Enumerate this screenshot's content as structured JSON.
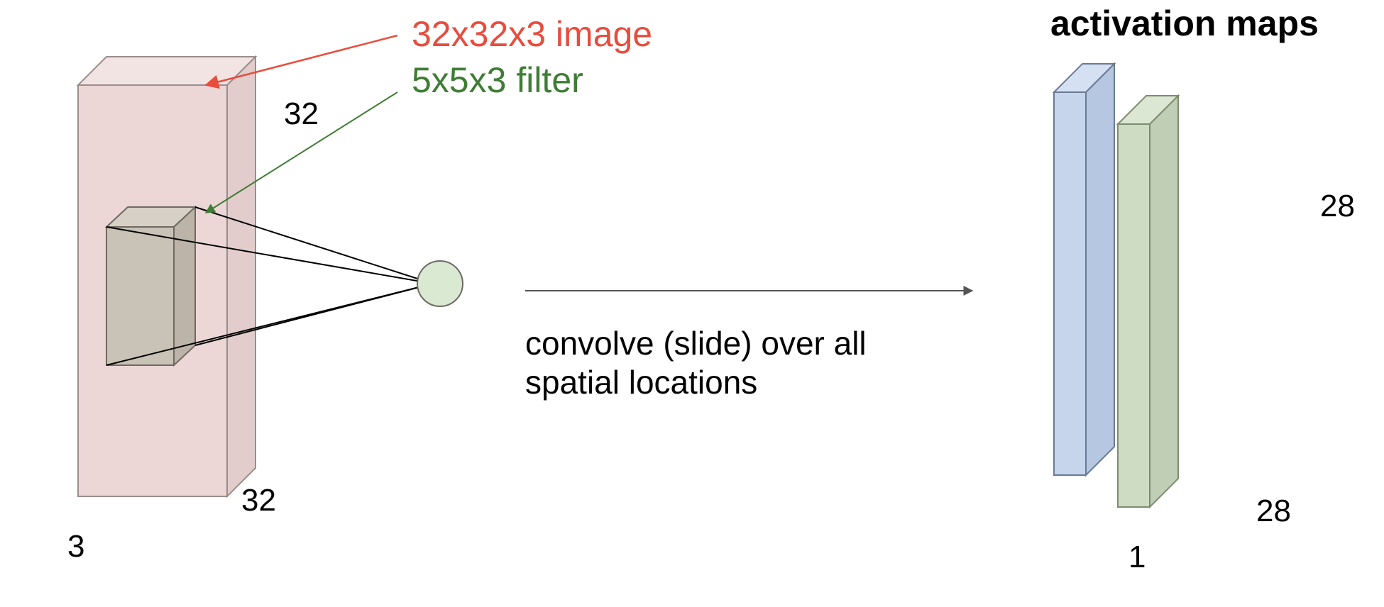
{
  "labels": {
    "image": "32x32x3 image",
    "filter": "5x5x3 filter",
    "activation_maps": "activation maps",
    "convolve_line1": "convolve (slide) over all",
    "convolve_line2": "spatial locations"
  },
  "dims": {
    "input_height": "32",
    "input_width": "32",
    "input_depth": "3",
    "output_height": "28",
    "output_width": "28",
    "output_depth": "1"
  },
  "colors": {
    "image_label": "#e84c3d",
    "filter_label": "#3f7d35",
    "input_slab_fill": "#ecd6d6",
    "input_slab_stroke": "#9b8d8d",
    "filter_slab_fill": "#c9c2b7",
    "filter_slab_stroke": "#6f6a62",
    "neuron_fill": "#d9e9d2",
    "neuron_stroke": "#6f6a62",
    "activation_blue_fill": "#c6d5eb",
    "activation_blue_stroke": "#6a7a95",
    "activation_green_fill": "#cddcc3",
    "activation_green_stroke": "#7c8c70",
    "arrow_red": "#e84c3d",
    "arrow_green": "#3f7d35",
    "arrow_gray": "#555555"
  }
}
